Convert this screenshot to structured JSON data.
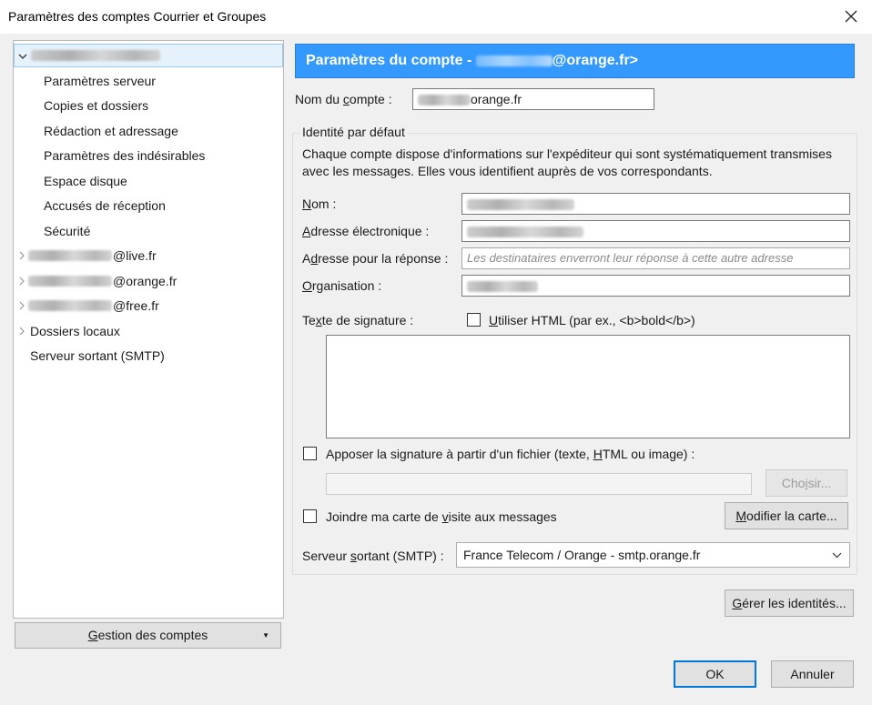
{
  "window": {
    "title": "Paramètres des comptes Courrier et Groupes"
  },
  "sidebar": {
    "account_main": {
      "label": ""
    },
    "subitems": [
      "Paramètres serveur",
      "Copies et dossiers",
      "Rédaction et adressage",
      "Paramètres des indésirables",
      "Espace disque",
      "Accusés de réception",
      "Sécurité"
    ],
    "accounts": [
      {
        "suffix": "@live.fr"
      },
      {
        "suffix": "@orange.fr"
      },
      {
        "suffix": "@free.fr"
      }
    ],
    "local_folders": "Dossiers locaux",
    "smtp": "Serveur sortant (SMTP)",
    "manage_accounts_button": {
      "pre": "",
      "ul": "G",
      "post": "estion des comptes"
    }
  },
  "main": {
    "header_prefix": "Paramètres du compte - ",
    "header_suffix": "@orange.fr>",
    "account_name": {
      "pre": "Nom du ",
      "ul": "c",
      "post": "ompte :",
      "value_suffix": "orange.fr"
    },
    "identity_group_title": "Identité par défaut",
    "identity_description": "Chaque compte dispose d'informations sur l'expéditeur qui sont systématiquement transmises avec les messages. Elles vous identifient auprès de vos correspondants.",
    "name": {
      "pre": "",
      "ul": "N",
      "post": "om :"
    },
    "email": {
      "pre": "",
      "ul": "A",
      "post": "dresse électronique :"
    },
    "reply_to": {
      "pre": "A",
      "ul": "d",
      "post": "resse pour la réponse :",
      "placeholder": "Les destinataires enverront leur réponse à cette autre adresse"
    },
    "organization": {
      "pre": "",
      "ul": "O",
      "post": "rganisation :"
    },
    "signature": {
      "pre": "Te",
      "ul": "x",
      "post": "te de signature :"
    },
    "use_html": {
      "pre": "",
      "ul": "U",
      "post": "tiliser HTML (par ex., <b>bold</b>)"
    },
    "attach_signature": {
      "pre": "Apposer la signature à partir d'un fichier (texte, ",
      "ul": "H",
      "post": "TML ou image) :"
    },
    "choose_button": {
      "pre": "Cho",
      "ul": "i",
      "post": "sir..."
    },
    "vcard": {
      "pre": "Joindre ma carte de ",
      "ul": "v",
      "post": "isite aux messages"
    },
    "edit_card_button": {
      "pre": "",
      "ul": "M",
      "post": "odifier la carte..."
    },
    "smtp_label": {
      "pre": "Serveur ",
      "ul": "s",
      "post": "ortant (SMTP) :"
    },
    "smtp_value": "France Telecom / Orange - smtp.orange.fr",
    "manage_identities_button": {
      "pre": "",
      "ul": "G",
      "post": "érer les identités..."
    }
  },
  "footer": {
    "ok": "OK",
    "cancel": "Annuler"
  }
}
